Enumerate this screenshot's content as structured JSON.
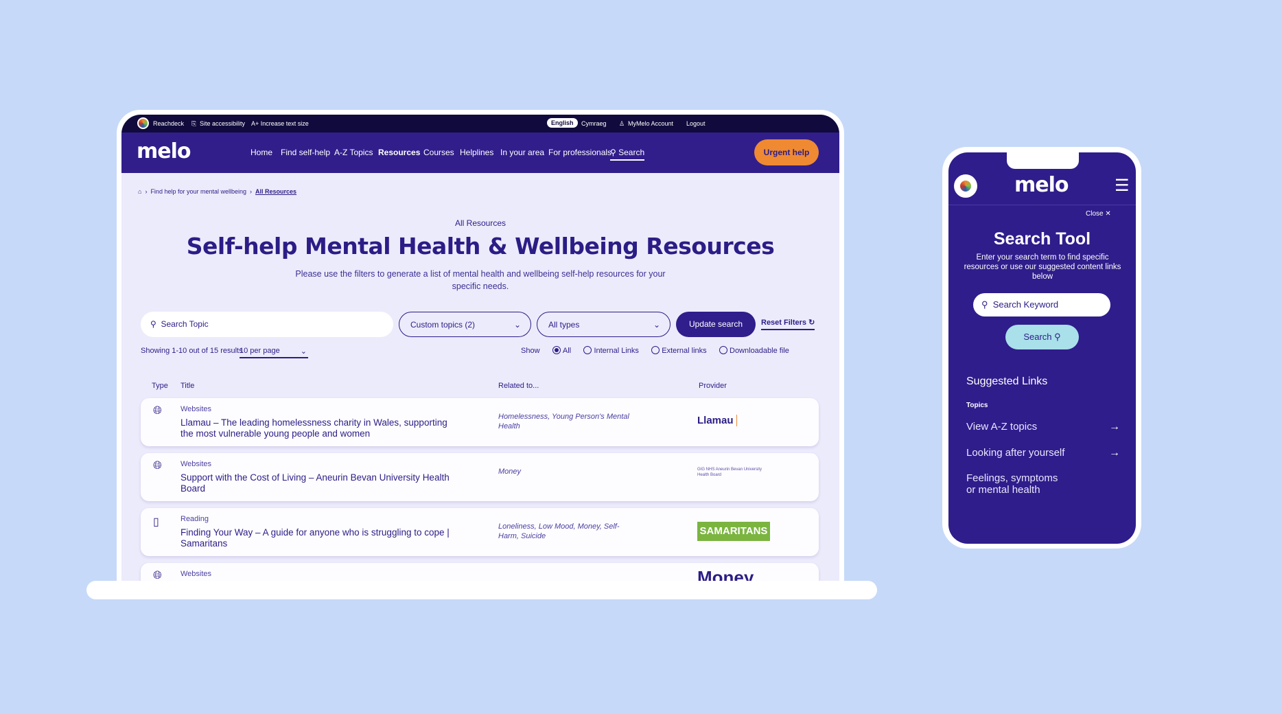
{
  "topbar": {
    "reachdeck": "Reachdeck",
    "accessibility": "Site accessibility",
    "text_size": "A+ Increase text size",
    "lang_en": "English",
    "lang_cy": "Cymraeg",
    "account": "MyMelo Account",
    "logout": "Logout"
  },
  "nav": {
    "logo": "melo",
    "items": [
      "Home",
      "Find self-help",
      "A-Z Topics",
      "Resources",
      "Courses",
      "Helplines",
      "In your area",
      "For professionals"
    ],
    "search": "Search",
    "urgent": "Urgent help"
  },
  "breadcrumb": [
    "Find help for your mental wellbeing",
    "All Resources"
  ],
  "header": {
    "eyebrow": "All Resources",
    "title": "Self-help Mental Health & Wellbeing Resources",
    "desc1": "Please use the filters to generate a list of mental health and wellbeing self-help resources for your",
    "desc2": "specific needs."
  },
  "filters": {
    "search_placeholder": "Search Topic",
    "topics": "Custom topics (2)",
    "types": "All types",
    "update": "Update search",
    "reset": "Reset Filters",
    "showing": "Showing 1-10 out of 15 results",
    "per_page": "10 per page",
    "show": "Show",
    "options": [
      "All",
      "Internal Links",
      "External links",
      "Downloadable file"
    ],
    "selected": "All"
  },
  "table": {
    "headers": [
      "Type",
      "Title",
      "Related to...",
      "Provider"
    ],
    "rows": [
      {
        "type": "Websites",
        "icon": "globe-icon",
        "title": "Llamau – The leading homelessness charity in Wales, supporting the most vulnerable young people and women",
        "related": "Homelessness, Young Person's Mental Health",
        "provider": "Llamau"
      },
      {
        "type": "Websites",
        "icon": "globe-icon",
        "title": "Support with the Cost of Living – Aneurin Bevan University Health Board",
        "related": "Money",
        "provider": "GIG NHS Aneurin Bevan University Health Board"
      },
      {
        "type": "Reading",
        "icon": "book-icon",
        "title": "Finding Your Way – A guide for anyone who is struggling to cope | Samaritans",
        "related": "Loneliness, Low Mood, Money, Self-Harm, Suicide",
        "provider": "SAMARITANS"
      },
      {
        "type": "Websites",
        "icon": "globe-icon",
        "title": "",
        "related": "",
        "provider": "Money"
      }
    ]
  },
  "mobile": {
    "logo": "melo",
    "close": "Close",
    "title": "Search Tool",
    "desc": "Enter your search term to find specific resources or use our suggested content links below",
    "placeholder": "Search Keyword",
    "search": "Search",
    "suggested": "Suggested Links",
    "topics": "Topics",
    "links": [
      "View A-Z topics",
      "Looking after yourself",
      "Feelings, symptoms or mental health"
    ]
  },
  "colors": {
    "background": "#c6d9f9",
    "nav": "#311e8b",
    "topbar": "#100b3c",
    "accent": "#ef8a33",
    "content": "#ecebfb",
    "mobile_button": "#a9e0ea"
  }
}
